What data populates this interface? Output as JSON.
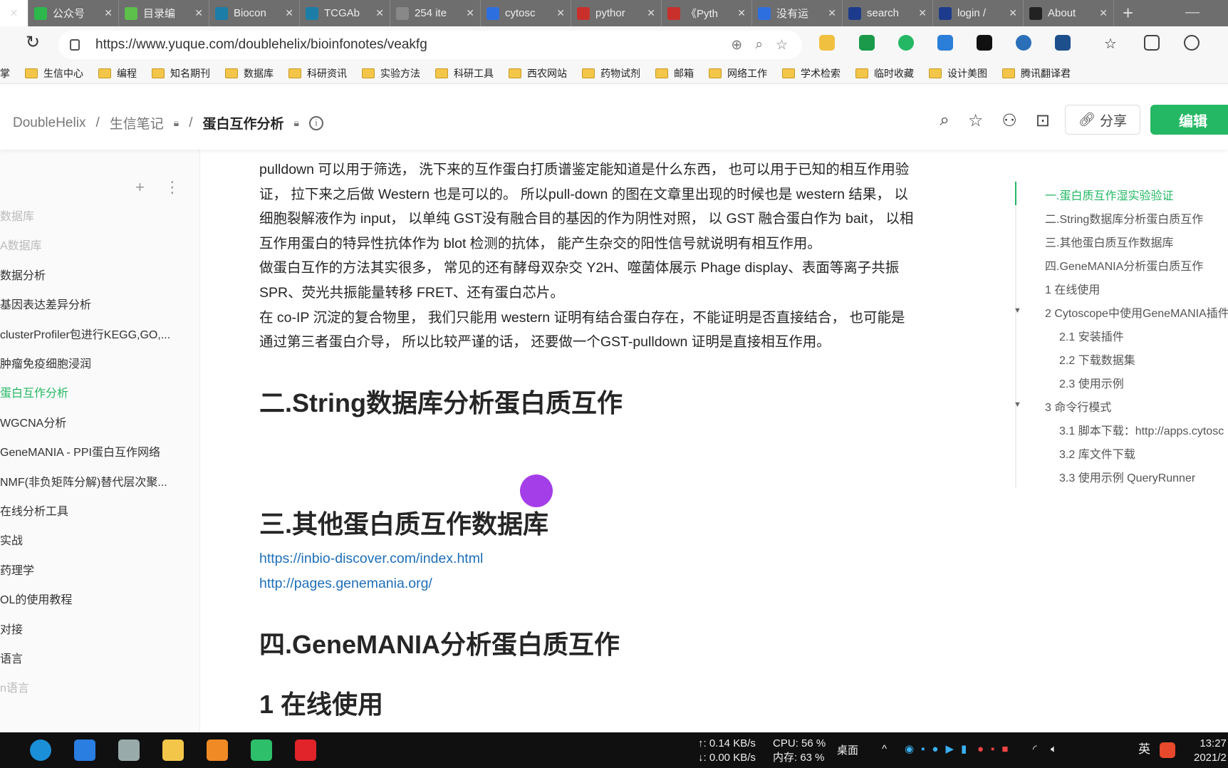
{
  "browser": {
    "tabs": [
      {
        "label": "公众号",
        "icon": "wechat-icon",
        "color": "#2db84b"
      },
      {
        "label": "目录编",
        "icon": "leaf-icon",
        "color": "#5cc04a"
      },
      {
        "label": "Biocon",
        "icon": "bioconductor-icon",
        "color": "#1c7ea8"
      },
      {
        "label": "TCGAb",
        "icon": "bioconductor-icon",
        "color": "#1c7ea8"
      },
      {
        "label": "254 ite",
        "icon": "loading-icon",
        "color": "#888888"
      },
      {
        "label": "cytosc",
        "icon": "baidu-icon",
        "color": "#2e6fe0"
      },
      {
        "label": "pythor",
        "icon": "jd-icon",
        "color": "#c9302c"
      },
      {
        "label": "《Pyth",
        "icon": "jd-icon",
        "color": "#c9302c"
      },
      {
        "label": "没有运",
        "icon": "baidu-icon",
        "color": "#2e6fe0"
      },
      {
        "label": "search",
        "icon": "info-icon",
        "color": "#1d3b8c"
      },
      {
        "label": "login /",
        "icon": "info-icon",
        "color": "#1d3b8c"
      },
      {
        "label": "About",
        "icon": "github-icon",
        "color": "#222222"
      }
    ],
    "url": "https://www.yuque.com/doublehelix/bioinfonotes/veakfg",
    "bookmarks": [
      "掌",
      "生信中心",
      "编程",
      "知名期刊",
      "数据库",
      "科研资讯",
      "实验方法",
      "科研工具",
      "西农网站",
      "药物试剂",
      "邮箱",
      "网络工作",
      "学术检索",
      "临时收藏",
      "设计美图",
      "腾讯翻译君"
    ]
  },
  "header": {
    "breadcrumb": [
      "DoubleHelix",
      "生信笔记",
      "蛋白互作分析"
    ],
    "share_label": "分享",
    "edit_label": "编辑",
    "accent": "#25b864"
  },
  "sidebar": {
    "items": [
      {
        "label": "数据库",
        "state": "faded"
      },
      {
        "label": "A数据库",
        "state": "faded"
      },
      {
        "label": "数据分析",
        "state": ""
      },
      {
        "label": "基因表达差异分析",
        "state": ""
      },
      {
        "label": "clusterProfiler包进行KEGG,GO,...",
        "state": ""
      },
      {
        "label": "肿瘤免疫细胞浸润",
        "state": ""
      },
      {
        "label": "蛋白互作分析",
        "state": "active"
      },
      {
        "label": "WGCNA分析",
        "state": ""
      },
      {
        "label": "GeneMANIA - PPI蛋白互作网络",
        "state": ""
      },
      {
        "label": "NMF(非负矩阵分解)替代层次聚...",
        "state": ""
      },
      {
        "label": "在线分析工具",
        "state": ""
      },
      {
        "label": "实战",
        "state": ""
      },
      {
        "label": "药理学",
        "state": ""
      },
      {
        "label": "OL的使用教程",
        "state": ""
      },
      {
        "label": "对接",
        "state": ""
      },
      {
        "label": "语言",
        "state": ""
      },
      {
        "label": "n语言",
        "state": "faded"
      }
    ]
  },
  "content": {
    "paragraphs": [
      "pulldown 可以用于筛选， 洗下来的互作蛋白打质谱鉴定能知道是什么东西， 也可以用于已知的相互作用验",
      "证， 拉下来之后做 Western 也是可以的。 所以pull-down 的图在文章里出现的时候也是 western 结果， 以",
      "细胞裂解液作为 input， 以单纯 GST没有融合目的基因的作为阴性对照， 以 GST 融合蛋白作为 bait， 以相",
      "互作用蛋白的特异性抗体作为 blot 检测的抗体， 能产生杂交的阳性信号就说明有相互作用。",
      "做蛋白互作的方法其实很多， 常见的还有酵母双杂交 Y2H、噬菌体展示 Phage display、表面等离子共振",
      "SPR、荧光共振能量转移 FRET、还有蛋白芯片。",
      "在 co-IP 沉淀的复合物里， 我们只能用 western 证明有结合蛋白存在，不能证明是否直接结合， 也可能是",
      "通过第三者蛋白介导， 所以比较严谨的话， 还要做一个GST-pulldown 证明是直接相互作用。"
    ],
    "h_string": "二.String数据库分析蛋白质互作",
    "h_other": "三.其他蛋白质互作数据库",
    "links": [
      "https://inbio-discover.com/index.html",
      "http://pages.genemania.org/"
    ],
    "h_genemania": "四.GeneMANIA分析蛋白质互作",
    "h_online": "1 在线使用"
  },
  "toc": {
    "items": [
      {
        "label": "一.蛋白质互作湿实验验证",
        "level": 1,
        "active": true
      },
      {
        "label": "二.String数据库分析蛋白质互作",
        "level": 1
      },
      {
        "label": "三.其他蛋白质互作数据库",
        "level": 1
      },
      {
        "label": "四.GeneMANIA分析蛋白质互作",
        "level": 1
      },
      {
        "label": "1 在线使用",
        "level": 1
      },
      {
        "label": "2 Cytoscope中使用GeneMANIA插件",
        "level": 1,
        "expanded": true
      },
      {
        "label": "2.1 安装插件",
        "level": 2
      },
      {
        "label": "2.2 下载数据集",
        "level": 2
      },
      {
        "label": "2.3 使用示例",
        "level": 2
      },
      {
        "label": "3 命令行模式",
        "level": 1,
        "expanded": true
      },
      {
        "label": "3.1 脚本下载：http://apps.cytosc",
        "level": 2
      },
      {
        "label": "3.2 库文件下载",
        "level": 2
      },
      {
        "label": "3.3 使用示例 QueryRunner",
        "level": 2
      }
    ]
  },
  "taskbar": {
    "net_up": "↑: 0.14 KB/s",
    "net_down": "↓: 0.00 KB/s",
    "cpu": "CPU: 56 %",
    "mem": "内存: 63 %",
    "desktop": "桌面",
    "ime": "英",
    "time": "13:27",
    "date": "2021/2"
  }
}
